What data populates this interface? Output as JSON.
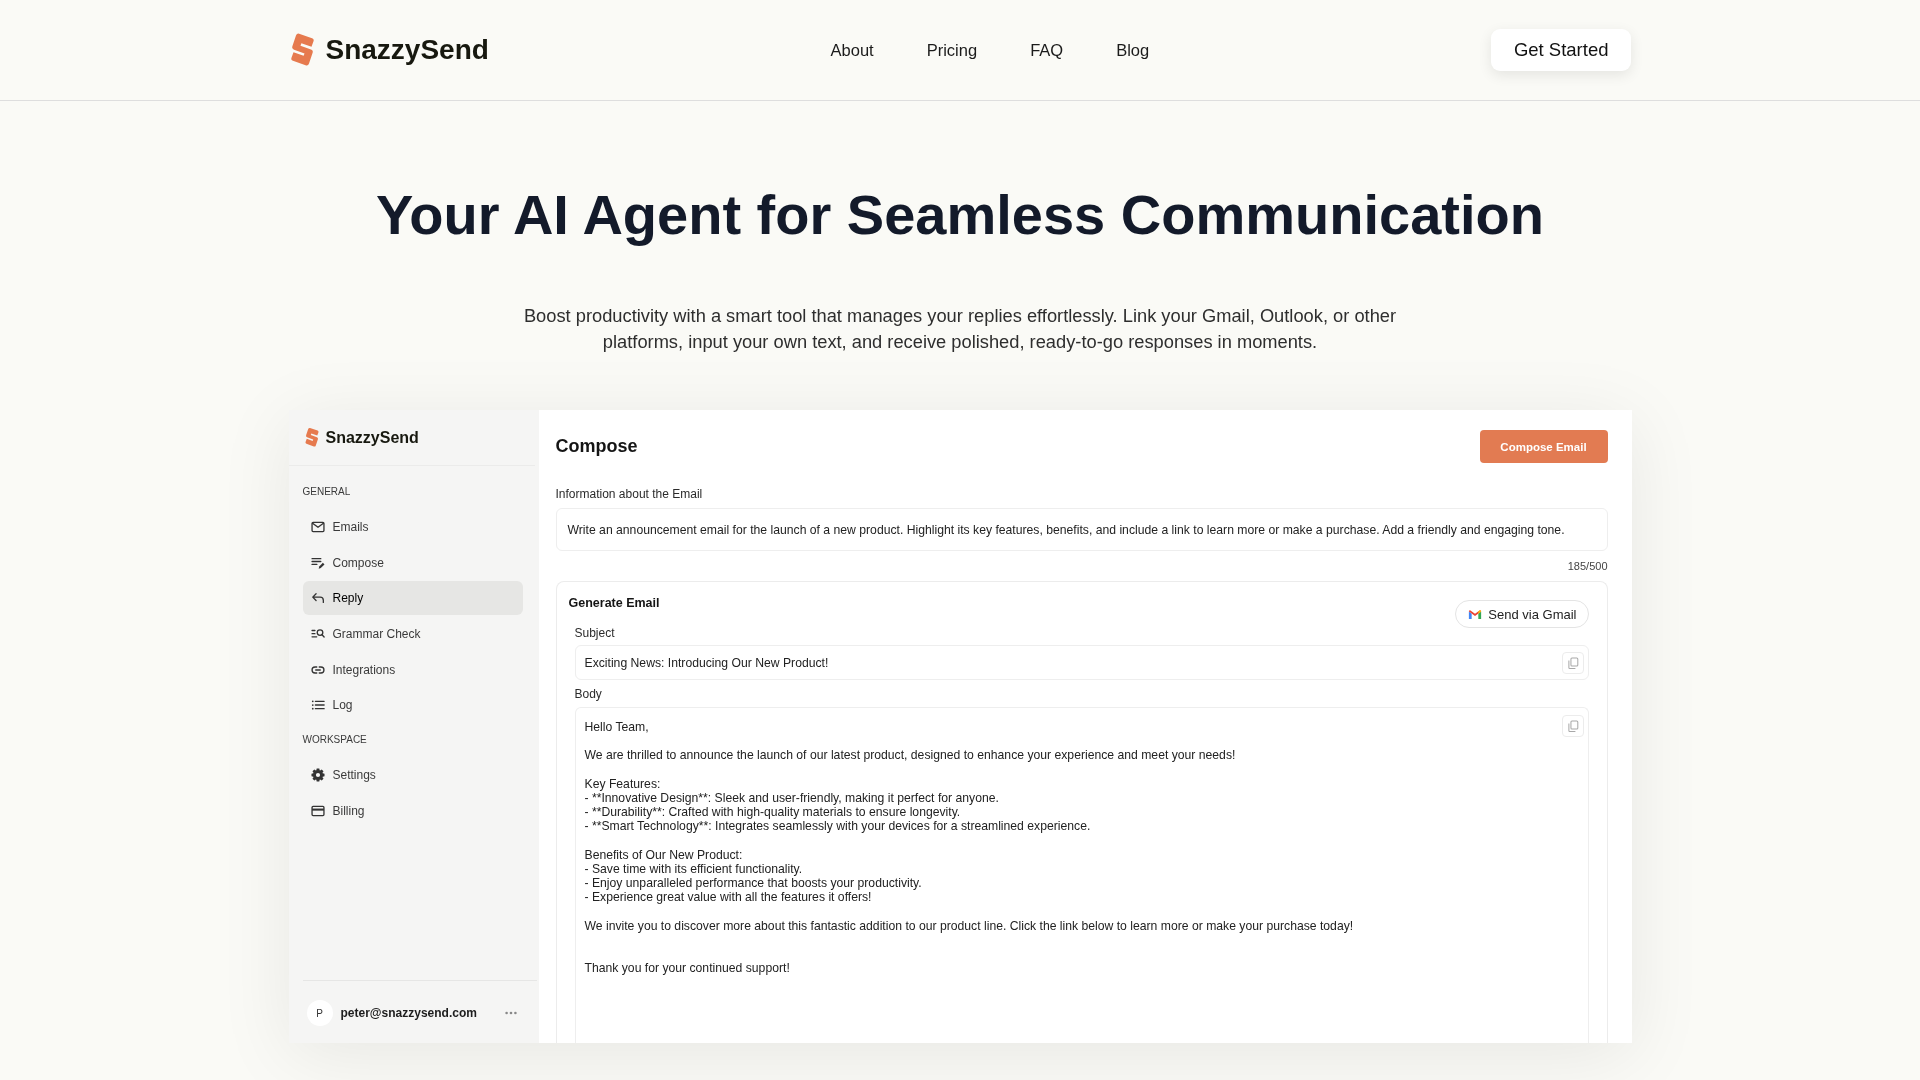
{
  "header": {
    "logo": "SnazzySend",
    "nav": [
      "About",
      "Pricing",
      "FAQ",
      "Blog"
    ],
    "cta": "Get Started"
  },
  "hero": {
    "title": "Your AI Agent for Seamless Communication",
    "subtitle": "Boost productivity with a smart tool that manages your replies effortlessly. Link your Gmail, Outlook, or other platforms, input your own text, and receive polished, ready-to-go responses in moments."
  },
  "app": {
    "sidebar": {
      "logo": "SnazzySend",
      "sections": [
        {
          "heading": "GENERAL",
          "items": [
            {
              "label": "Emails",
              "selected": false
            },
            {
              "label": "Compose",
              "selected": false
            },
            {
              "label": "Reply",
              "selected": true
            },
            {
              "label": "Grammar Check",
              "selected": false
            },
            {
              "label": "Integrations",
              "selected": false
            },
            {
              "label": "Log",
              "selected": false
            }
          ]
        },
        {
          "heading": "WORKSPACE",
          "items": [
            {
              "label": "Settings",
              "selected": false
            },
            {
              "label": "Billing",
              "selected": false
            }
          ]
        }
      ],
      "account": {
        "avatar": "P",
        "email": "peter@snazzysend.com"
      }
    },
    "compose": {
      "title": "Compose",
      "button": "Compose Email",
      "info": {
        "label": "Information about the Email",
        "value": "Write an announcement email for the launch of a new product. Highlight its key features, benefits, and include a link to learn more or make a purchase. Add a friendly and engaging tone.",
        "counter": "185/500"
      },
      "generate": {
        "title": "Generate Email",
        "send_button": "Send via Gmail",
        "subject": {
          "label": "Subject",
          "value": "Exciting News: Introducing Our New Product!"
        },
        "body": {
          "label": "Body",
          "value": "Hello Team,\n\nWe are thrilled to announce the launch of our latest product, designed to enhance your experience and meet your needs!\n\nKey Features:\n- **Innovative Design**: Sleek and user-friendly, making it perfect for anyone.\n- **Durability**: Crafted with high-quality materials to ensure longevity.\n- **Smart Technology**: Integrates seamlessly with your devices for a streamlined experience.\n\nBenefits of Our New Product:\n- Save time with its efficient functionality.\n- Enjoy unparalleled performance that boosts your productivity.\n- Experience great value with all the features it offers!\n\nWe invite you to discover more about this fantastic addition to our product line. Click the link below to learn more or make your purchase today!\n\n\nThank you for your continued support!"
        }
      }
    }
  }
}
